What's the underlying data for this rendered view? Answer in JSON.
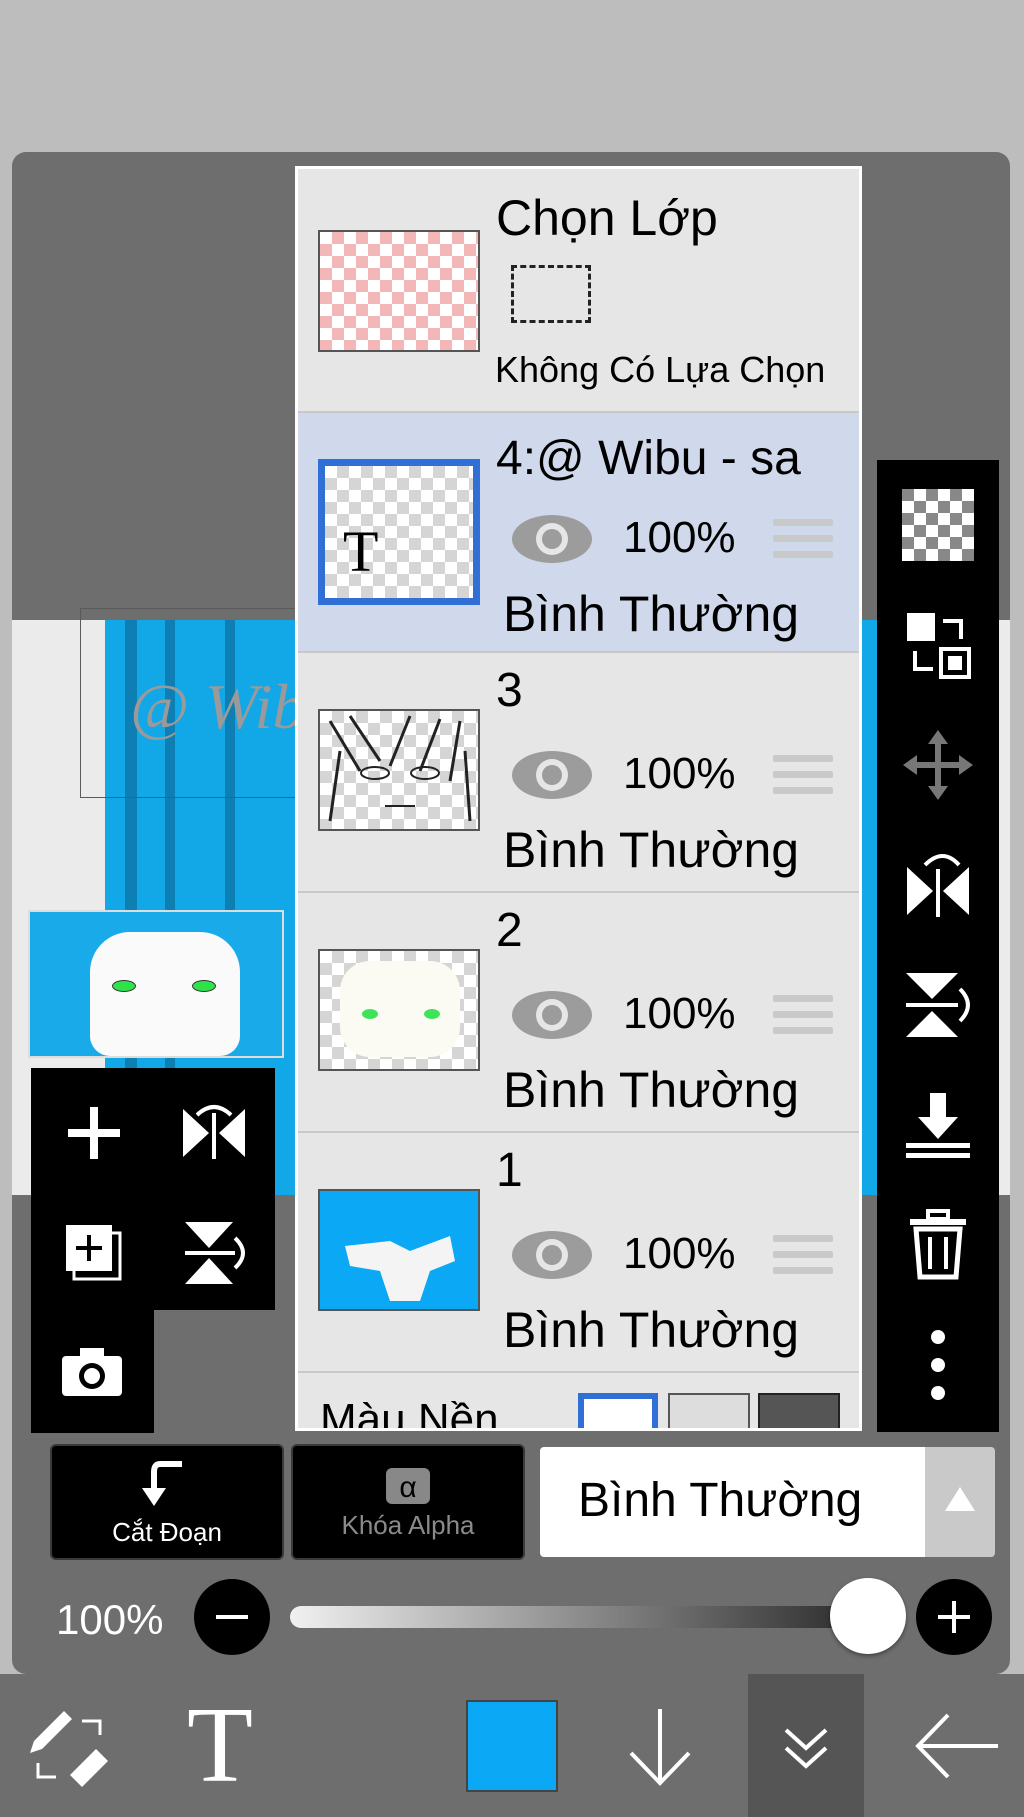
{
  "layer_panel": {
    "selection_layer": {
      "title": "Chọn Lớp",
      "status": "Không Có Lựa Chọn"
    },
    "layers": [
      {
        "name": "4:@ Wibu - sa",
        "opacity": "100%",
        "blend": "Bình Thường",
        "selected": true
      },
      {
        "name": "3",
        "opacity": "100%",
        "blend": "Bình Thường",
        "selected": false
      },
      {
        "name": "2",
        "opacity": "100%",
        "blend": "Bình Thường",
        "selected": false
      },
      {
        "name": "1",
        "opacity": "100%",
        "blend": "Bình Thường",
        "selected": false
      }
    ],
    "background_label": "Màu Nền",
    "text_layer_glyph": "T"
  },
  "canvas": {
    "watermark_text": "@ Wibu"
  },
  "controls": {
    "clipping_label": "Cắt Đoạn",
    "alpha_lock_label": "Khóa Alpha",
    "alpha_glyph": "α",
    "blend_mode": "Bình Thường",
    "opacity_label": "100%",
    "opacity_value": 1.0
  },
  "bottom_bar": {
    "text_tool_glyph": "T",
    "color_hex": "#0aa8f5"
  },
  "colors": {
    "accent": "#2f6fd6",
    "selected_row": "#cfd9eb",
    "current_color": "#0aa8f5"
  }
}
